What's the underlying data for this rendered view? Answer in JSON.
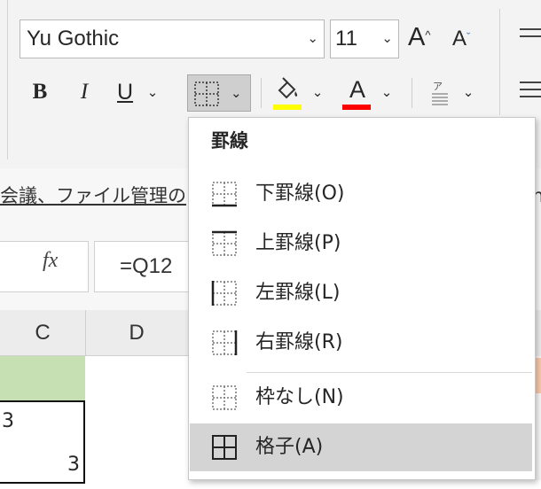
{
  "ribbon": {
    "font_name": "Yu Gothic",
    "font_size": "11",
    "grow_font": "A",
    "shrink_font": "A",
    "bold": "B",
    "italic": "I",
    "underline": "U",
    "font_color_letter": "A",
    "fill_color": "#ffff00",
    "font_color": "#ff0000"
  },
  "sheet": {
    "link_text": "会議、ファイル管理の共",
    "right_char": "n",
    "fx": "fx",
    "formula": "=Q12",
    "columns": [
      "C",
      "D"
    ],
    "cell_c1": "3",
    "cell_c2": "3"
  },
  "menu": {
    "title": "罫線",
    "items": [
      {
        "label": "下罫線(O)",
        "icon": "bottom-border-icon"
      },
      {
        "label": "上罫線(P)",
        "icon": "top-border-icon"
      },
      {
        "label": "左罫線(L)",
        "icon": "left-border-icon"
      },
      {
        "label": "右罫線(R)",
        "icon": "right-border-icon"
      },
      {
        "label": "枠なし(N)",
        "icon": "no-border-icon"
      },
      {
        "label": "格子(A)",
        "icon": "all-borders-icon"
      }
    ],
    "selected_index": 5
  }
}
